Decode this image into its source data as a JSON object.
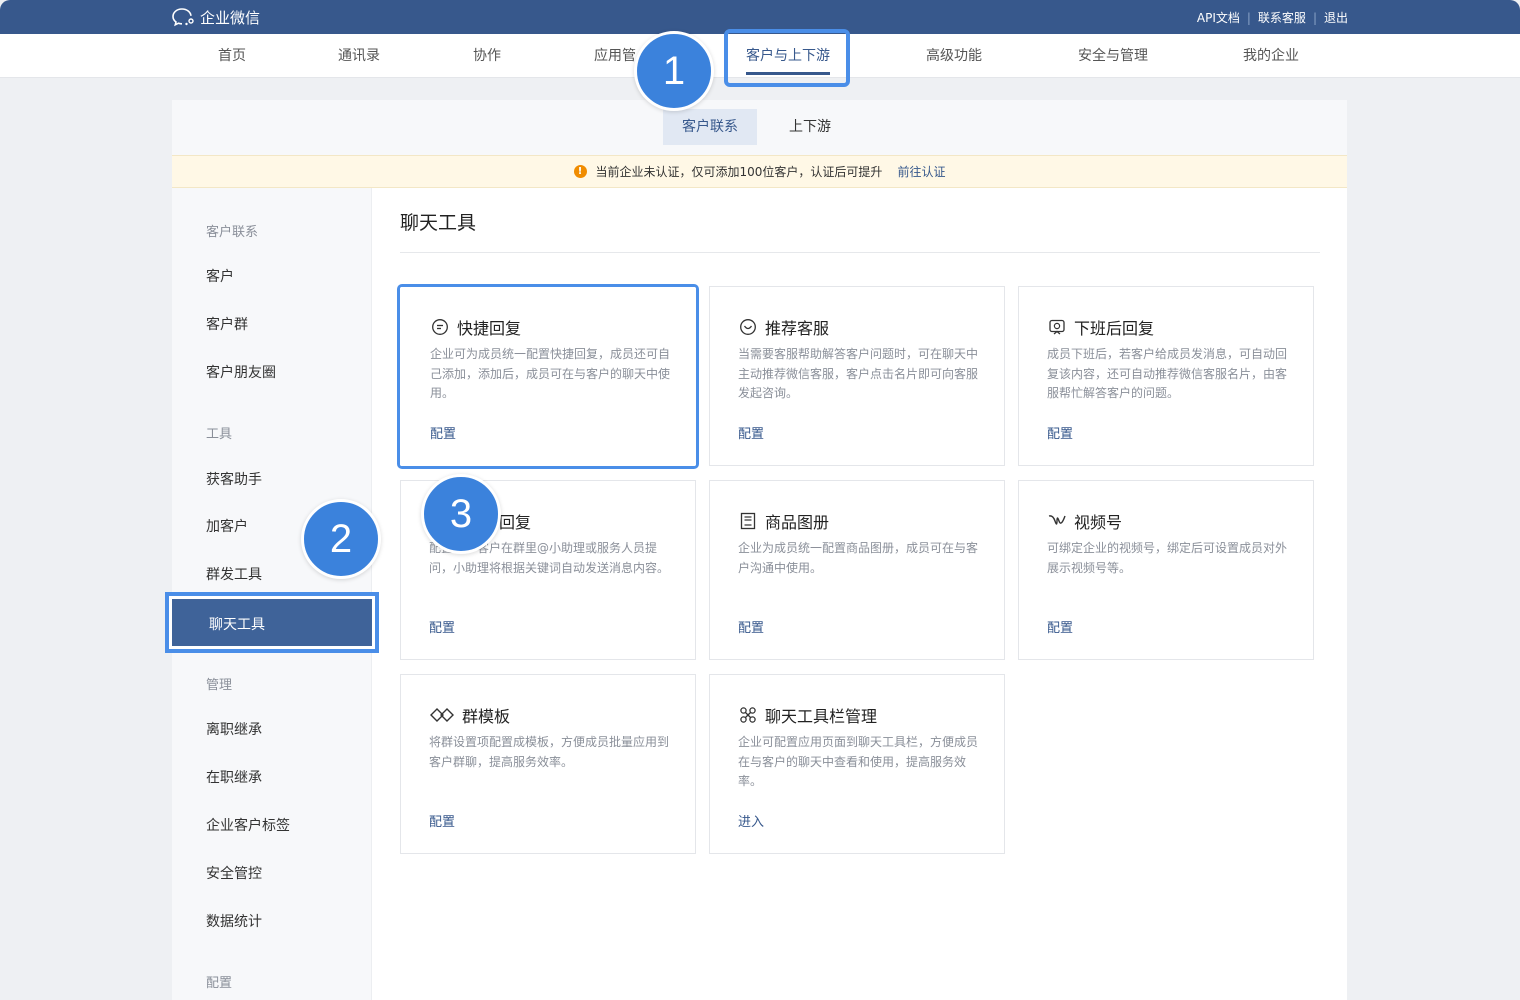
{
  "header": {
    "logo_text": "企业微信",
    "links": [
      "API文档",
      "联系客服",
      "退出"
    ]
  },
  "nav": {
    "items": [
      "首页",
      "通讯录",
      "协作",
      "应用管",
      "客户与上下游",
      "高级功能",
      "安全与管理",
      "我的企业"
    ],
    "active_index": 4
  },
  "subtabs": [
    "客户联系",
    "上下游"
  ],
  "notice": {
    "text": "当前企业未认证，仅可添加100位客户，认证后可提升",
    "link": "前往认证"
  },
  "sidebar": {
    "group1": "客户联系",
    "items1": [
      "客户",
      "客户群",
      "客户朋友圈"
    ],
    "group2": "工具",
    "items2": [
      "获客助手",
      "加客户",
      "群发工具",
      "聊天工具"
    ],
    "group3": "管理",
    "items3": [
      "离职继承",
      "在职继承",
      "企业客户标签",
      "安全管控",
      "数据统计"
    ],
    "group4": "配置"
  },
  "content": {
    "title": "聊天工具",
    "cards": [
      {
        "title": "快捷回复",
        "icon": "quick-reply-icon",
        "desc": "企业可为成员统一配置快捷回复，成员还可自己添加，添加后，成员可在与客户的聊天中使用。",
        "link": "配置"
      },
      {
        "title": "推荐客服",
        "icon": "service-chat-icon",
        "desc": "当需要客服帮助解答客户问题时，可在聊天中主动推荐微信客服，客户点击名片即可向客服发起咨询。",
        "link": "配置"
      },
      {
        "title": "下班后回复",
        "icon": "offwork-reply-icon",
        "desc": "成员下班后，若客户给成员发消息，可自动回复该内容，还可自动推荐微信客服名片，由客服帮忙解答客户的问题。",
        "link": "配置"
      },
      {
        "title": "回复",
        "icon": "group-assistant-icon",
        "desc": "配置后，客户在群里@小助理或服务人员提问，小助理将根据关键词自动发送消息内容。",
        "link": "配置"
      },
      {
        "title": "商品图册",
        "icon": "product-album-icon",
        "desc": "企业为成员统一配置商品图册，成员可在与客户沟通中使用。",
        "link": "配置"
      },
      {
        "title": "视频号",
        "icon": "channels-icon",
        "desc": "可绑定企业的视频号，绑定后可设置成员对外展示视频号等。",
        "link": "配置"
      },
      {
        "title": "群模板",
        "icon": "group-template-icon",
        "desc": "将群设置项配置成模板，方便成员批量应用到客户群聊，提高服务效率。",
        "link": "配置"
      },
      {
        "title": "聊天工具栏管理",
        "icon": "toolbar-manage-icon",
        "desc": "企业可配置应用页面到聊天工具栏，方便成员在与客户的聊天中查看和使用，提高服务效率。",
        "link": "进入"
      }
    ]
  },
  "badges": [
    "1",
    "2",
    "3"
  ]
}
